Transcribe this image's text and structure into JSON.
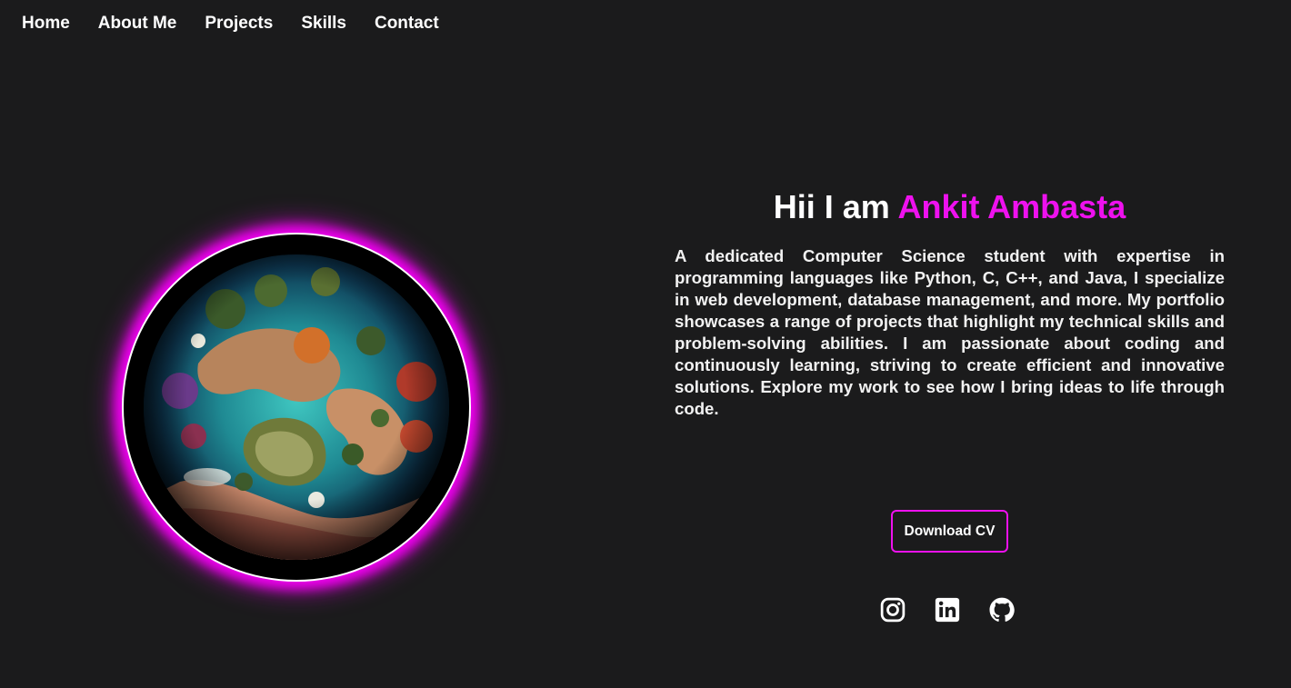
{
  "nav": {
    "items": [
      {
        "label": "Home"
      },
      {
        "label": "About Me"
      },
      {
        "label": "Projects"
      },
      {
        "label": "Skills"
      },
      {
        "label": "Contact"
      }
    ]
  },
  "hero": {
    "greeting": "Hii I am",
    "name": "Ankit Ambasta",
    "bio": "A dedicated Computer Science student with expertise in programming languages like Python, C, C++, and Java, I specialize in web development, database management, and more. My portfolio showcases a range of projects that highlight my technical skills and problem-solving abilities. I am passionate about coding and continuously learning, striving to create efficient and innovative solutions. Explore my work to see how I bring ideas to life through code.",
    "cv_button": "Download CV",
    "image_icon": "planet-globe-image"
  },
  "socials": [
    {
      "icon": "instagram-icon"
    },
    {
      "icon": "linkedin-icon"
    },
    {
      "icon": "github-icon"
    }
  ],
  "colors": {
    "background": "#1b1b1c",
    "accent": "#ee11ee",
    "text": "#ffffff"
  }
}
